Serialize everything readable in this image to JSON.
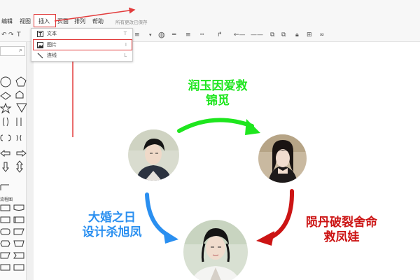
{
  "menubar": {
    "items": [
      "编辑",
      "视图",
      "插入",
      "页面",
      "排列",
      "帮助"
    ],
    "save_status": "所有更改已保存"
  },
  "insert_menu": {
    "items": [
      {
        "icon": "text-icon",
        "label": "文本",
        "shortcut": "T"
      },
      {
        "icon": "image-icon",
        "label": "图片",
        "shortcut": "I"
      },
      {
        "icon": "connector-icon",
        "label": "连线",
        "shortcut": "L"
      }
    ]
  },
  "shape_panel": {
    "flowchart_header": "流程图"
  },
  "diagram": {
    "top_label": [
      "润玉因爱救",
      "锦觅"
    ],
    "left_label": [
      "大婚之日",
      "设计杀旭凤"
    ],
    "right_label": [
      "陨丹破裂舍命",
      "救凤娃"
    ],
    "colors": {
      "green": "#1ee61e",
      "blue": "#2a8ff0",
      "red": "#cc1414",
      "highlight": "#e23c3c"
    }
  }
}
